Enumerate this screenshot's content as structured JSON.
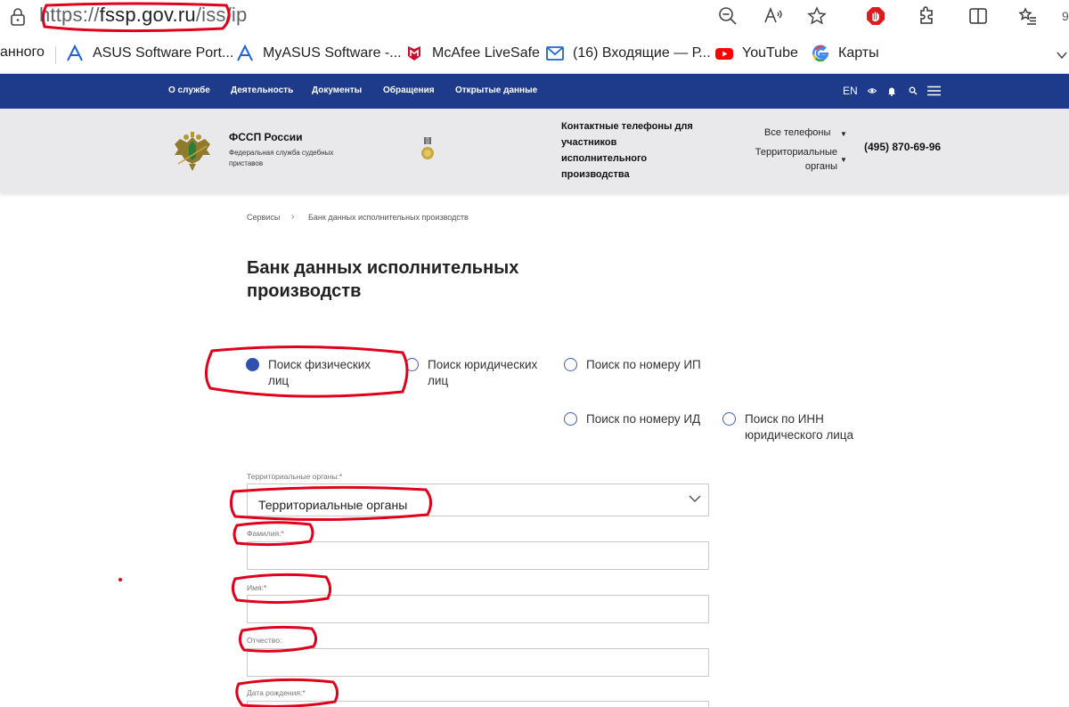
{
  "browser": {
    "url_scheme": "https://",
    "url_host": "fssp.gov.ru",
    "url_path": "/iss/ip",
    "edge_char": "9",
    "bookmarks": [
      {
        "label": "анного",
        "icon": "none"
      },
      {
        "label": "ASUS Software Port...",
        "icon": "asus-icon"
      },
      {
        "label": "MyASUS Software -...",
        "icon": "asus-icon"
      },
      {
        "label": "McAfee LiveSafe",
        "icon": "mcafee-icon"
      },
      {
        "label": "(16) Входящие — Р...",
        "icon": "mail-icon"
      },
      {
        "label": "YouTube",
        "icon": "youtube-icon"
      },
      {
        "label": "Карты",
        "icon": "google-icon"
      }
    ]
  },
  "nav": {
    "items": [
      "О службе",
      "Деятельность",
      "Документы",
      "Обращения",
      "Открытые данные"
    ],
    "lang": "EN"
  },
  "header": {
    "org_name": "ФССП России",
    "org_sub": "Федеральная служба судебных приставов",
    "contacts": "Контактные телефоны для участников исполнительного производства",
    "all_phones": "Все телефоны",
    "territorial": "Территориальные органы",
    "phone": "(495) 870-69-96"
  },
  "breadcrumb": {
    "items": [
      "Сервисы",
      "Банк данных исполнительных производств"
    ],
    "separator": "›"
  },
  "page": {
    "title": "Банк данных исполнительных производств"
  },
  "search_types": [
    {
      "label": "Поиск физических лиц",
      "checked": true
    },
    {
      "label": "Поиск юридических лиц",
      "checked": false
    },
    {
      "label": "Поиск по номеру ИП",
      "checked": false
    },
    {
      "label": "Поиск по номеру ИД",
      "checked": false
    },
    {
      "label": "Поиск по ИНН юридического лица",
      "checked": false
    }
  ],
  "form": {
    "territorial_label": "Территориальные органы:*",
    "territorial_value": "Территориальные органы",
    "surname_label": "Фамилия:*",
    "name_label": "Имя:*",
    "patronymic_label": "Отчество:",
    "birthdate_label": "Дата рождения:*"
  },
  "colors": {
    "nav_bg": "#1d3b8a",
    "header_bg": "#e9e9ec",
    "radio_accent": "#3050b0",
    "annotation": "#e0001b"
  }
}
